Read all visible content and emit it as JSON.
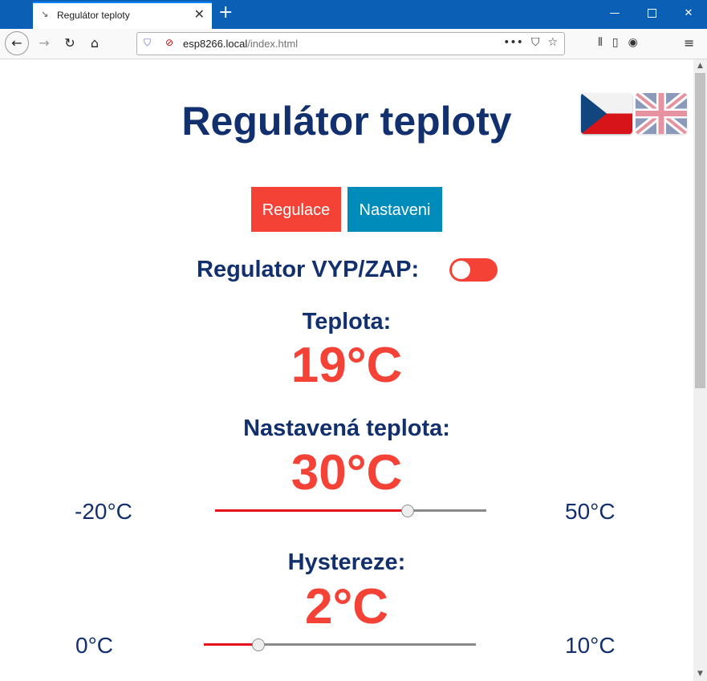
{
  "browser": {
    "tab_title": "Regulátor teploty",
    "url_host": "esp8266.local",
    "url_path": "/index.html"
  },
  "page": {
    "title": "Regulátor teploty",
    "languages": [
      "CZ",
      "EN"
    ],
    "buttons": {
      "regulation": "Regulace",
      "settings": "Nastaveni"
    },
    "toggle": {
      "label": "Regulator VYP/ZAP:",
      "state": "off"
    },
    "temperature": {
      "label": "Teplota:",
      "value": "19°C"
    },
    "set_temperature": {
      "label": "Nastavená teplota:",
      "value": "30°C",
      "min_label": "-20°C",
      "max_label": "50°C",
      "slider_level": 0.71
    },
    "hysteresis": {
      "label": "Hystereze:",
      "value": "2°C",
      "min_label": "0°C",
      "max_label": "10°C",
      "slider_level": 0.2
    }
  },
  "colors": {
    "heading": "#12306e",
    "accent_red": "#f44336",
    "accent_blue": "#008cba",
    "browser_titlebar": "#0b5fb4"
  }
}
